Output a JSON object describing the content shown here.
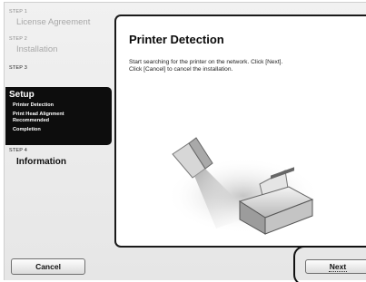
{
  "sidebar": {
    "step1": {
      "tag": "STEP 1",
      "title": "License Agreement"
    },
    "step2": {
      "tag": "STEP 2",
      "title": "Installation"
    },
    "step3": {
      "tag": "STEP 3",
      "title": "Setup",
      "substeps": [
        "Printer Detection",
        "Print Head Alignment",
        "Recommended",
        "Completion"
      ]
    },
    "step4": {
      "tag": "STEP 4",
      "title": "Information"
    }
  },
  "main": {
    "title": "Printer Detection",
    "message_line1": "Start searching for the printer on the network. Click [Next].",
    "message_line2": "Click [Cancel] to cancel the installation."
  },
  "buttons": {
    "cancel": "Cancel",
    "next": "Next"
  },
  "illustration": {
    "icon": "printer-detection-illustration"
  }
}
